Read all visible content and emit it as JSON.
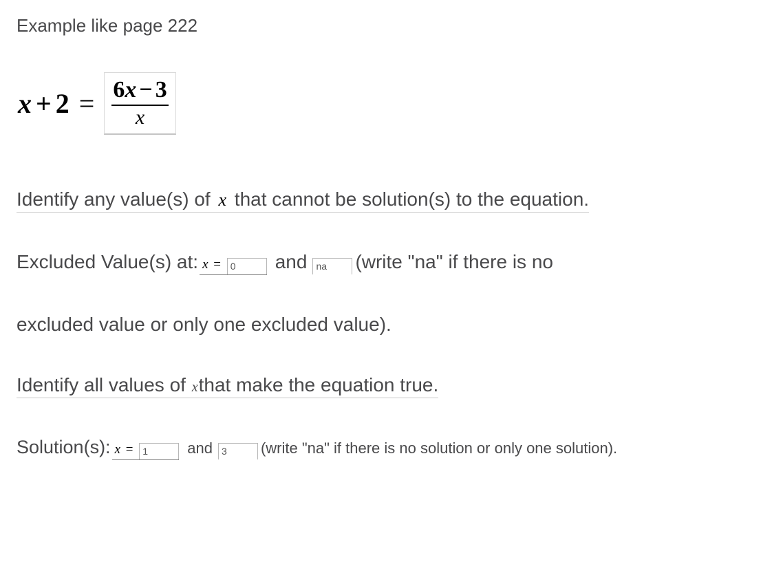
{
  "page_reference": "Example like page 222",
  "equation": {
    "lhs_var": "x",
    "lhs_plus": "+",
    "lhs_const": "2",
    "equals": "=",
    "numerator_coef": "6",
    "numerator_var": "x",
    "numerator_minus": "−",
    "numerator_const": "3",
    "denominator": "x"
  },
  "instruction1_pre": "Identify any value(s) of ",
  "instruction1_var": "x",
  "instruction1_post": " that cannot  be solution(s) to the equation.",
  "excluded": {
    "label": "Excluded Value(s) at: ",
    "var": "x",
    "eq": " =",
    "value1": "0",
    "and": " and ",
    "value2": "na",
    "hint": " (write \"na\" if there is no"
  },
  "excluded_cont": "excluded value or only one excluded value).",
  "instruction2_pre": "Identify all values of ",
  "instruction2_var": "x",
  "instruction2_post": "that make the equation true.",
  "solution": {
    "label": "Solution(s): ",
    "var": "x",
    "eq": " =",
    "value1": "1",
    "and": " and ",
    "value2": "3",
    "hint": " (write \"na\" if there is no solution or only one solution)."
  }
}
